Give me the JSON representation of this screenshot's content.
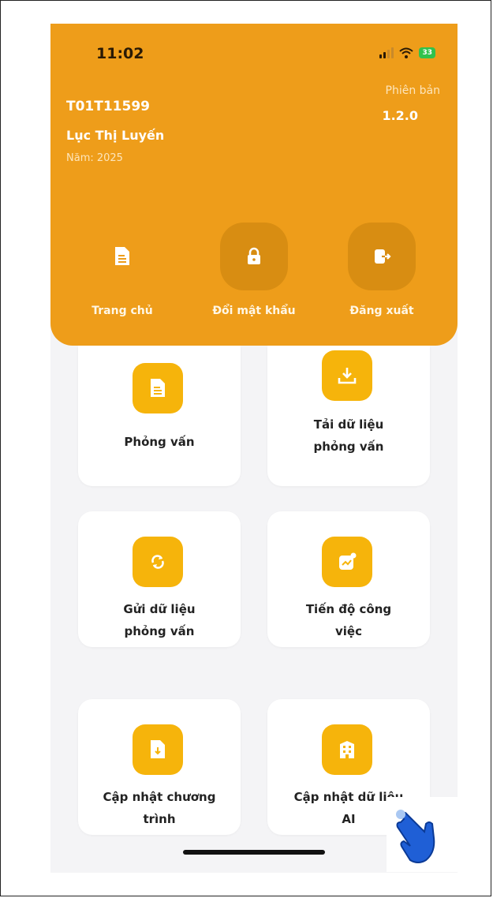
{
  "status": {
    "time": "11:02",
    "battery": "33"
  },
  "header": {
    "user_id": "T01T11599",
    "user_name": "Lục Thị Luyến",
    "year": "Năm: 2025",
    "version_label": "Phiên bản",
    "version_value": "1.2.0"
  },
  "menu": [
    {
      "label": "Trang chủ",
      "icon": "document-icon"
    },
    {
      "label": "Đổi mật khẩu",
      "icon": "lock-icon"
    },
    {
      "label": "Đăng xuất",
      "icon": "logout-icon"
    }
  ],
  "cards": [
    {
      "label": "Phỏng vấn",
      "icon": "document-icon"
    },
    {
      "label": "Tải dữ liệu phỏng vấn",
      "icon": "download-icon"
    },
    {
      "label": "Gửi dữ liệu phỏng vấn",
      "icon": "sync-icon"
    },
    {
      "label": "Tiến độ công việc",
      "icon": "chart-icon"
    },
    {
      "label": "Cập nhật chương trình",
      "icon": "file-download-icon"
    },
    {
      "label": "Cập nhật dữ liệu AI",
      "icon": "building-icon"
    }
  ],
  "colors": {
    "header": "#ee9d1a",
    "icon_bg": "#f6b40b",
    "background": "#f4f4f6"
  }
}
